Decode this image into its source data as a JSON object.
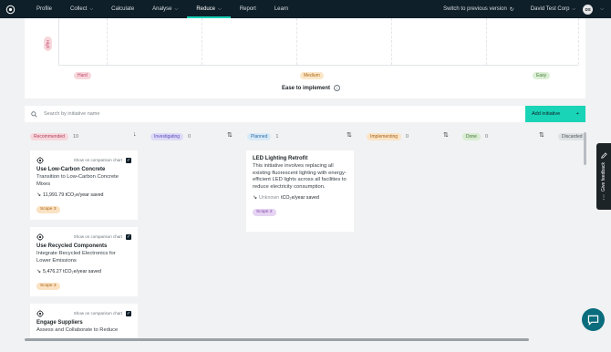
{
  "nav": {
    "items": [
      {
        "label": "Profile",
        "dropdown": false,
        "active": false
      },
      {
        "label": "Collect",
        "dropdown": true,
        "active": false
      },
      {
        "label": "Calculate",
        "dropdown": false,
        "active": false
      },
      {
        "label": "Analyse",
        "dropdown": true,
        "active": false
      },
      {
        "label": "Reduce",
        "dropdown": true,
        "active": true
      },
      {
        "label": "Report",
        "dropdown": false,
        "active": false
      },
      {
        "label": "Learn",
        "dropdown": false,
        "active": false
      }
    ],
    "switch_label": "Switch to previous version",
    "org_name": "David Test Corp",
    "avatar_initials": "DS",
    "accent_color": "#18cfb5"
  },
  "chart": {
    "y_pill": "High",
    "x_pills": [
      "Hard",
      "Medium",
      "Easy"
    ],
    "x_title": "Ease to implement"
  },
  "search": {
    "placeholder": "Search by initiative name",
    "value": ""
  },
  "add_button": {
    "label": "Add initiative",
    "icon": "+"
  },
  "columns": [
    {
      "label": "Recommended",
      "count": "10"
    },
    {
      "label": "Investigating",
      "count": "0"
    },
    {
      "label": "Planned",
      "count": "1"
    },
    {
      "label": "Implementing",
      "count": "0"
    },
    {
      "label": "Done",
      "count": "0"
    },
    {
      "label": "Discarded",
      "count": ""
    }
  ],
  "show_on_chart_label": "Show on comparison chart",
  "recommended_cards": [
    {
      "title": "Use Low-Carbon Concrete",
      "subtitle": "Transition to Low-Carbon Concrete Mixes",
      "saved": "11,991.79 tCO₂e/year saved",
      "scope": "Scope 3"
    },
    {
      "title": "Use Recycled Components",
      "subtitle": "Integrate Recycled Electronics for Lower Emissions",
      "saved": "5,476.27 tCO₂e/year saved",
      "scope": "Scope 3"
    },
    {
      "title": "Engage Suppliers",
      "subtitle": "Assess and Collaborate to Reduce",
      "saved": "",
      "scope": ""
    }
  ],
  "planned_card": {
    "title": "LED Lighting Retrofit",
    "description": "This initiative involves replacing all existing fluorescent lighting with energy-efficient LED lights across all facilities to reduce electricity consumption.",
    "saved_unknown": "Unknown",
    "saved_rest": " tCO₂e/year saved",
    "scope": "Scope 2"
  },
  "feedback_label": "Give feedback"
}
